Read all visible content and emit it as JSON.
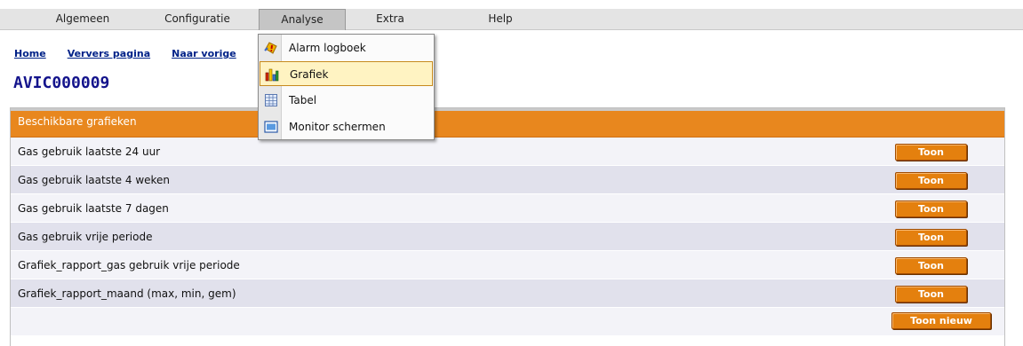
{
  "menubar": {
    "items": [
      "Algemeen",
      "Configuratie",
      "Analyse",
      "Extra",
      "Help"
    ],
    "active": "Analyse"
  },
  "links": [
    "Home",
    "Ververs pagina",
    "Naar vorige"
  ],
  "page_title": "AVIC000009",
  "panel": {
    "header": "Beschikbare grafieken",
    "rows": [
      {
        "label": "Gas gebruik laatste 24 uur",
        "button": "Toon"
      },
      {
        "label": "Gas gebruik laatste 4 weken",
        "button": "Toon"
      },
      {
        "label": "Gas gebruik laatste 7 dagen",
        "button": "Toon"
      },
      {
        "label": "Gas gebruik vrije periode",
        "button": "Toon"
      },
      {
        "label": "Grafiek_rapport_gas gebruik vrije periode",
        "button": "Toon"
      },
      {
        "label": "Grafiek_rapport_maand (max, min, gem)",
        "button": "Toon"
      }
    ],
    "new_button": "Toon nieuw"
  },
  "dropdown": {
    "items": [
      {
        "label": "Alarm logboek",
        "icon": "alarm-icon"
      },
      {
        "label": "Grafiek",
        "icon": "chart-icon",
        "selected": true
      },
      {
        "label": "Tabel",
        "icon": "table-icon"
      },
      {
        "label": "Monitor schermen",
        "icon": "monitor-icon"
      }
    ]
  },
  "colors": {
    "accent": "#e8871e",
    "title": "#14148c",
    "link": "#002288"
  }
}
